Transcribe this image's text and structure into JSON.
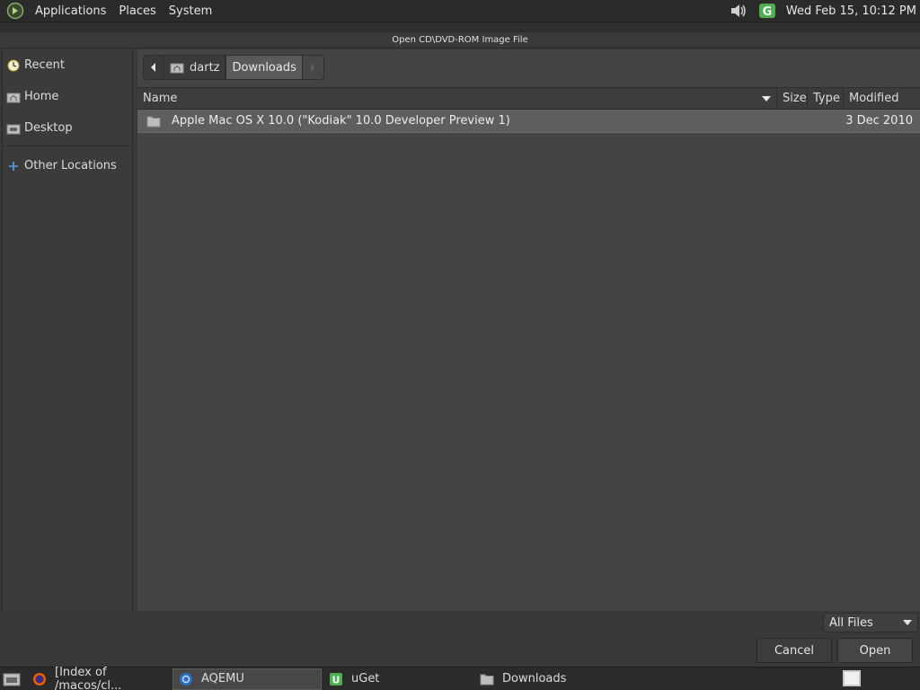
{
  "top_panel": {
    "menus": [
      "Applications",
      "Places",
      "System"
    ],
    "clock": "Wed Feb 15, 10:12 PM"
  },
  "dialog": {
    "title": "Open CD\\DVD-ROM Image File",
    "sidebar": {
      "items": [
        {
          "label": "Recent",
          "icon": "clock-icon"
        },
        {
          "label": "Home",
          "icon": "home-folder-icon"
        },
        {
          "label": "Desktop",
          "icon": "desktop-folder-icon"
        }
      ],
      "other": {
        "label": "Other Locations",
        "icon": "plus-icon"
      }
    },
    "pathbar": {
      "segments": [
        "dartz",
        "Downloads"
      ]
    },
    "columns": {
      "name": "Name",
      "size": "Size",
      "type": "Type",
      "modified": "Modified"
    },
    "files": [
      {
        "name": "Apple Mac OS X 10.0 (\"Kodiak\" 10.0 Developer Preview 1)",
        "size": "",
        "type": "",
        "modified": "3 Dec 2010",
        "icon": "folder-icon"
      }
    ],
    "filter": "All Files",
    "buttons": {
      "cancel": "Cancel",
      "open": "Open"
    }
  },
  "taskbar": {
    "tasks": [
      {
        "label": "[Index of /macos/cl...",
        "icon": "firefox-icon",
        "active": false
      },
      {
        "label": "AQEMU",
        "icon": "aqemu-icon",
        "active": true
      },
      {
        "label": "uGet",
        "icon": "uget-icon",
        "active": false
      },
      {
        "label": "Downloads",
        "icon": "folder-icon",
        "active": false
      }
    ]
  },
  "colors": {
    "selection": "#5e5e5e",
    "accent_green": "#4caf50"
  }
}
